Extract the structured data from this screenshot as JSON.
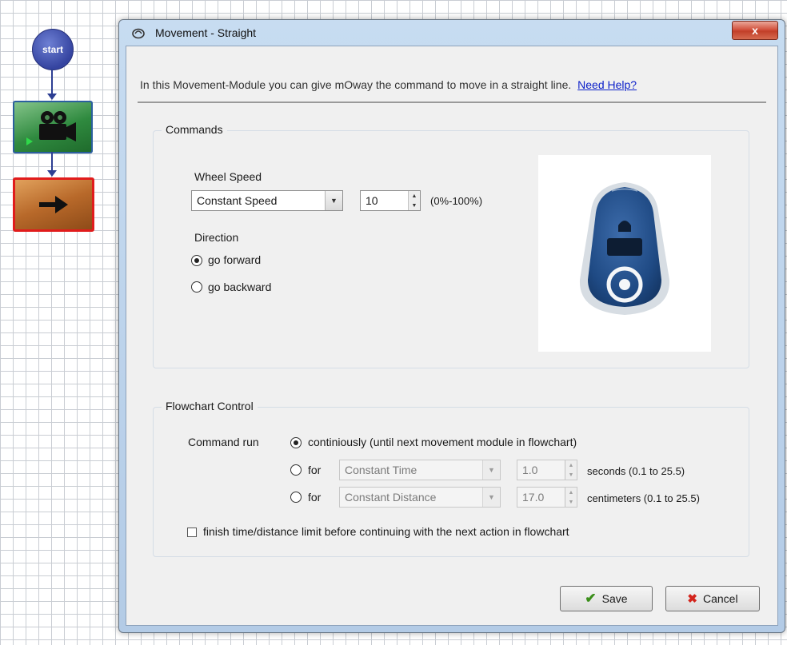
{
  "flowchart": {
    "start_label": "start",
    "blocks": [
      "video-camera-icon",
      "arrow-right-icon"
    ]
  },
  "dialog": {
    "title": "Movement - Straight",
    "close_label": "x",
    "intro_text": "In this Movement-Module you can give mOway the command to move in a straight line.",
    "help_link": "Need Help?"
  },
  "commands": {
    "group_title": "Commands",
    "wheel_speed_label": "Wheel Speed",
    "speed_mode": "Constant Speed",
    "speed_value": "10",
    "speed_range": "(0%-100%)",
    "direction_label": "Direction",
    "forward_label": "go forward",
    "backward_label": "go backward",
    "direction_selected": "forward"
  },
  "flow_control": {
    "group_title": "Flowchart Control",
    "command_run_label": "Command run",
    "continuous_label": "continiously (until next movement module in flowchart)",
    "for_label": "for",
    "time_mode": "Constant Time",
    "time_value": "1.0",
    "time_units": "seconds (0.1 to 25.5)",
    "distance_mode": "Constant Distance",
    "distance_value": "17.0",
    "distance_units": "centimeters (0.1 to 25.5)",
    "finish_label": "finish time/distance limit before continuing with the next action in flowchart",
    "finish_checked": false
  },
  "buttons": {
    "save_label": "Save",
    "cancel_label": "Cancel"
  },
  "colors": {
    "robot_shell": "#1f4a84",
    "link": "#0b1fc9",
    "selected_block_border": "#e11c1c"
  }
}
